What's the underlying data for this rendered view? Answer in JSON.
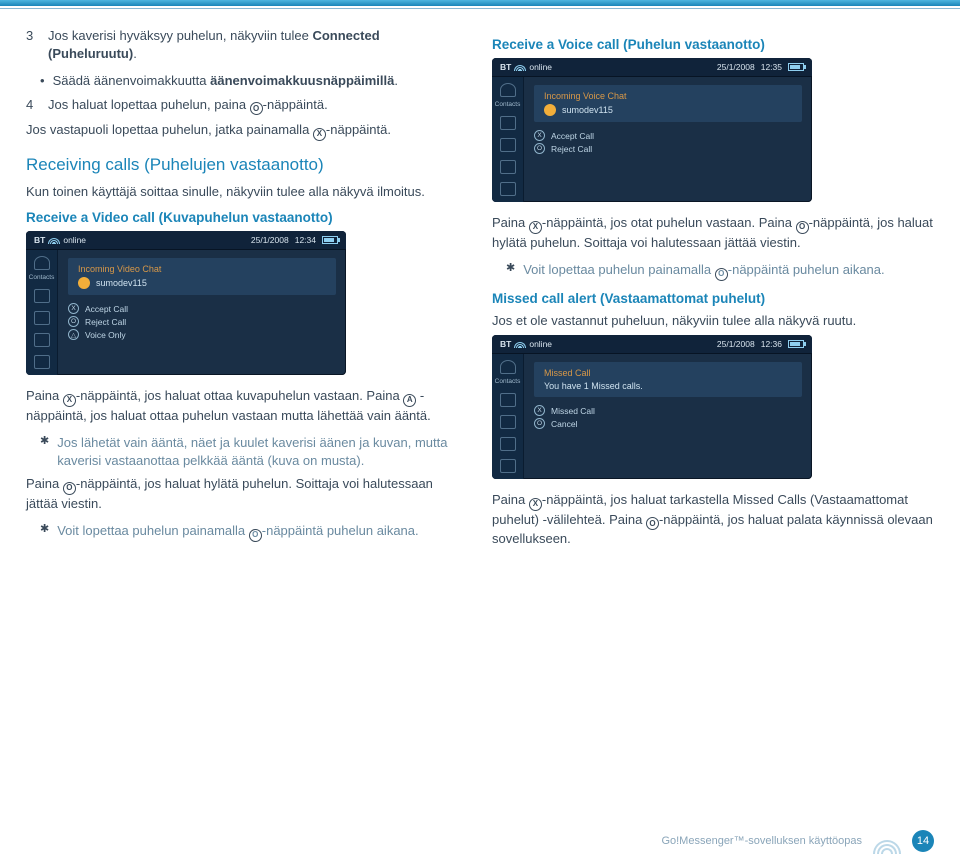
{
  "topline": {},
  "left": {
    "item3_pre": "Jos kaverisi hyväksyy puhelun, näkyviin tulee ",
    "item3_bold": "Connected (Puheluruutu)",
    "item3_suf": ".",
    "vol_pre": "Säädä äänenvoimakkuutta ",
    "vol_bold": "äänenvoimakkuusnäppäimillä",
    "vol_suf": ".",
    "item4_pre": "Jos haluat lopettaa puhelun, paina ",
    "item4_btn": "O",
    "item4_suf": "-näppäintä.",
    "other_pre": "Jos vastapuoli lopettaa puhelun, jatka painamalla ",
    "other_btn": "X",
    "other_suf": "-näppäintä.",
    "h_recv": "Receiving calls (Puhelujen vastaanotto)",
    "recv_body": "Kun toinen käyttäjä soittaa sinulle, näkyviin tulee alla näkyvä ilmoitus.",
    "h_video": "Receive a Video call (Kuvapuhelun vastaanotto)",
    "scr1": {
      "brand": "BT",
      "status": "online",
      "date": "25/1/2008",
      "time": "12:34",
      "side_lbl": "Contacts",
      "panel_title": "Incoming Video Chat",
      "caller": "sumodev115",
      "acts": [
        {
          "k": "X",
          "t": "Accept Call"
        },
        {
          "k": "O",
          "t": "Reject Call"
        },
        {
          "k": "△",
          "t": "Voice Only"
        }
      ]
    },
    "after1_a": "Paina ",
    "after1_b": "-näppäintä, jos haluat ottaa kuvapuhelun vastaan. Paina ",
    "after1_c": " -näppäintä, jos haluat ottaa puhelun vastaan mutta lähettää vain ääntä.",
    "note1": "Jos lähetät vain ääntä, näet ja kuulet kaverisi äänen ja kuvan, mutta kaverisi vastaanottaa pelkkää ääntä (kuva on musta).",
    "after2_a": "Paina ",
    "after2_b": "-näppäintä, jos haluat hylätä puhelun. Soittaja voi halutessaan jättää viestin.",
    "note2_a": "Voit lopettaa puhelun painamalla ",
    "note2_b": "-näppäintä puhelun aikana."
  },
  "right": {
    "h_voice": "Receive a Voice call (Puhelun vastaanotto)",
    "scr2": {
      "brand": "BT",
      "status": "online",
      "date": "25/1/2008",
      "time": "12:35",
      "side_lbl": "Contacts",
      "panel_title": "Incoming Voice Chat",
      "caller": "sumodev115",
      "acts": [
        {
          "k": "X",
          "t": "Accept Call"
        },
        {
          "k": "O",
          "t": "Reject Call"
        }
      ]
    },
    "p1_a": "Paina ",
    "p1_b": "-näppäintä, jos otat puhelun vastaan. Paina ",
    "p1_c": "-näppäintä, jos haluat hylätä puhelun. Soittaja voi halutessaan jättää viestin.",
    "note_a": "Voit lopettaa puhelun painamalla ",
    "note_b": "-näppäintä puhelun aikana.",
    "h_missed": "Missed call alert (Vastaamattomat puhelut)",
    "missed_body": "Jos et ole vastannut puheluun, näkyviin tulee alla näkyvä ruutu.",
    "scr3": {
      "brand": "BT",
      "status": "online",
      "date": "25/1/2008",
      "time": "12:36",
      "side_lbl": "Contacts",
      "panel_title": "Missed Call",
      "msg": "You have 1 Missed calls.",
      "acts": [
        {
          "k": "X",
          "t": "Missed Call"
        },
        {
          "k": "O",
          "t": "Cancel"
        }
      ]
    },
    "p2_a": "Paina ",
    "p2_b": "-näppäintä, jos haluat tarkastella Missed Calls (Vastaamattomat puhelut) -välilehteä. Paina ",
    "p2_c": "-näppäintä, jos haluat palata käynnissä olevaan sovellukseen."
  },
  "footer": {
    "label": "Go!Messenger™-sovelluksen käyttöopas",
    "page": "14"
  },
  "nums": {
    "n3": "3",
    "n4": "4"
  },
  "btns": {
    "X": "X",
    "O": "O",
    "A": "A"
  }
}
